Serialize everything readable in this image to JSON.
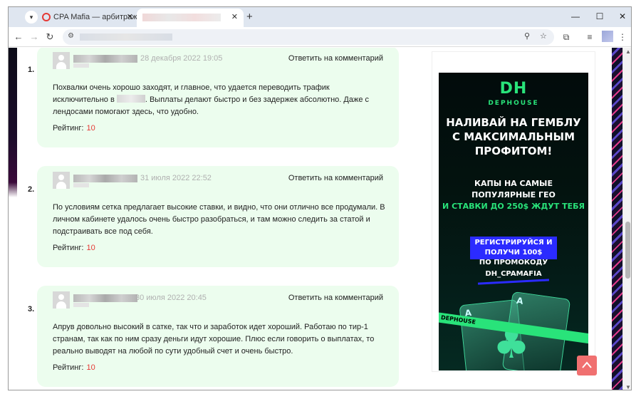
{
  "browser": {
    "tabs": [
      {
        "title": "CPA Mafia — арбитраж трафика"
      },
      {
        "title": ""
      }
    ],
    "new_tab": "+",
    "menu_icon": "chevron-down-icon",
    "window_controls": [
      "—",
      "☐",
      "✕"
    ]
  },
  "comments": [
    {
      "num": "1.",
      "date": "28 декабря 2022 19:05",
      "reply": "Ответить на комментарий",
      "text_before": "Похвалки очень хорошо заходят, и главное, что удается переводить трафик исключительно в",
      "text_after": ". Выплаты делают быстро и без задержек абсолютно. Даже с лендосами помогают здесь, что удобно.",
      "rating_label": "Рейтинг:",
      "rating": "10"
    },
    {
      "num": "2.",
      "date": "31 июля 2022 22:52",
      "reply": "Ответить на комментарий",
      "text": "По условиям сетка предлагает высокие ставки, и видно, что они отлично все продумали. В личном кабинете удалось очень быстро разобраться, и там можно следить за статой и подстраивать все под себя.",
      "rating_label": "Рейтинг:",
      "rating": "10"
    },
    {
      "num": "3.",
      "date": "30 июля 2022 20:45",
      "reply": "Ответить на комментарий",
      "text": "Апрув довольно высокий в сатке, так что и заработок идет хороший. Работаю по тир-1 странам, так как по ним сразу деньги идут хорошие. Плюс если говорить о выплатах, то реально выводят на любой по сути удобный счет и очень быстро.",
      "rating_label": "Рейтинг:",
      "rating": "10"
    }
  ],
  "banner": {
    "logo": "DH",
    "brand": "DEPHOUSE",
    "headline": "НАЛИВАЙ НА ГЕМБЛУ С МАКСИМАЛЬНЫМ ПРОФИТОМ!",
    "sub1": "КАПЫ НА САМЫЕ ПОПУЛЯРНЫЕ ГЕО",
    "sub2": "И СТАВКИ ДО 250$ ЖДУТ ТЕБЯ",
    "cta": "РЕГИСТРИРУЙСЯ И ПОЛУЧИ 100$",
    "promo_line1": "ПО ПРОМОКОДУ",
    "promo_code": "DH_CPAMAFIA",
    "tape_text": "DEPHOUSE"
  },
  "colors": {
    "comment_bg": "#ecfdee",
    "rating_value": "#e53935",
    "banner_green": "#29e37a",
    "cta_blue": "#2b2bff",
    "to_top": "#f07070"
  }
}
